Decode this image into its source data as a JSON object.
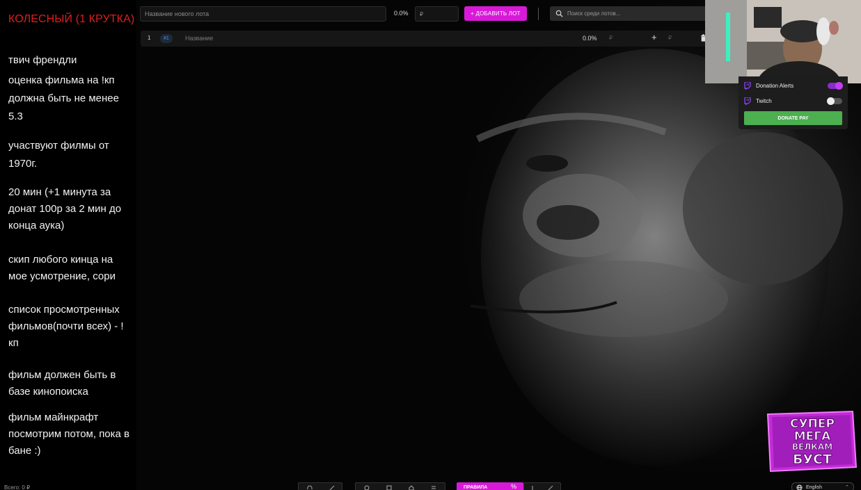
{
  "rules": {
    "title": "КОЛЕСНЫЙ (1 КРУТКА)",
    "items": [
      "твич френдли",
      "оценка фильма на !кп должна быть не менее 5.3",
      "участвуют филмы от 1970г.",
      "20 мин (+1 минута за донат 100р за 2 мин до конца аука)",
      "скип любого кинца на мое усмотрение, сори",
      "список просмотренных фильмов(почти всех) - !кп",
      "фильм должен быть в базе кинопоиска",
      "фильм майнкрафт посмотрим потом, пока в бане :)"
    ],
    "total_label": "Всего: 0 ₽"
  },
  "topbar": {
    "lot_name_placeholder": "Название нового лота",
    "percent": "0.0%",
    "amount_placeholder": "₽",
    "add_lot_label": "+ ДОБАВИТЬ ЛОТ",
    "search_placeholder": "Поиск среди лотов..."
  },
  "lot": {
    "index": "1",
    "id_badge": "#1",
    "name_placeholder": "Название",
    "percent": "0.0%",
    "currency": "₽",
    "add_symbol": "+",
    "currency2": "₽"
  },
  "integrations": {
    "items": [
      {
        "label": "Donation Alerts",
        "enabled": true
      },
      {
        "label": "Twitch",
        "enabled": false
      }
    ],
    "donate_pay_label": "DONATE PAY"
  },
  "boost_badge": {
    "lines": [
      "СУПЕР",
      "МЕГА",
      "ВЕЛКАМ",
      "БУСТ"
    ]
  },
  "bottom_toolbar": {
    "rules_label": "ПРАВИЛА",
    "percent_symbol": "%"
  },
  "language": {
    "selected": "English"
  },
  "colors": {
    "accent": "#d81ad8",
    "rules_title": "#e01e1e",
    "donate_pay": "#4caf50",
    "toggle_on": "#c23ff0"
  }
}
